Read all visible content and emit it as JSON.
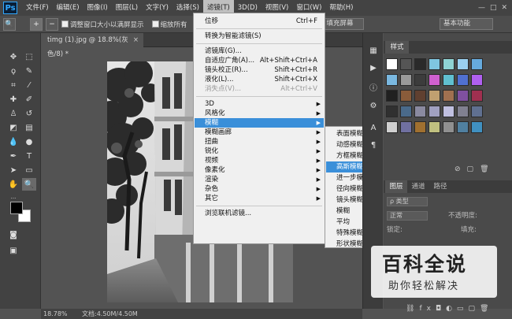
{
  "menubar": {
    "logo": "Ps",
    "items": [
      "文件(F)",
      "编辑(E)",
      "图像(I)",
      "图层(L)",
      "文字(Y)",
      "选择(S)",
      "滤镜(T)",
      "3D(D)",
      "视图(V)",
      "窗口(W)",
      "帮助(H)"
    ],
    "active_index": 6,
    "window_controls": [
      "—",
      "□",
      "✕"
    ]
  },
  "options_bar": {
    "fit_window_label": "调整窗口大小以满屏显示",
    "zoom_all_label": "缩放所有",
    "fill_screen_button": "填充屏幕",
    "workspace": "基本功能"
  },
  "document": {
    "tab_title": "timg (1).jpg @ 18.8%(灰色/8) *",
    "close": "×",
    "status_zoom": "18.78%",
    "status_doc": "文档:4.50M/4.50M"
  },
  "filter_menu": {
    "items": [
      {
        "label": "位移",
        "shortcut": "Ctrl+F"
      },
      {
        "sep": true
      },
      {
        "label": "转换为智能滤镜(S)"
      },
      {
        "sep": true
      },
      {
        "label": "滤镜库(G)..."
      },
      {
        "label": "自适应广角(A)...",
        "shortcut": "Alt+Shift+Ctrl+A"
      },
      {
        "label": "镜头校正(R)...",
        "shortcut": "Shift+Ctrl+R"
      },
      {
        "label": "液化(L)...",
        "shortcut": "Shift+Ctrl+X"
      },
      {
        "label": "消失点(V)...",
        "shortcut": "Alt+Ctrl+V",
        "disabled": true
      },
      {
        "sep": true
      },
      {
        "label": "3D",
        "submenu": true
      },
      {
        "label": "风格化",
        "submenu": true
      },
      {
        "label": "模糊",
        "submenu": true,
        "highlight": true
      },
      {
        "label": "模糊画廊",
        "submenu": true
      },
      {
        "label": "扭曲",
        "submenu": true
      },
      {
        "label": "锐化",
        "submenu": true
      },
      {
        "label": "视频",
        "submenu": true
      },
      {
        "label": "像素化",
        "submenu": true
      },
      {
        "label": "渲染",
        "submenu": true
      },
      {
        "label": "杂色",
        "submenu": true
      },
      {
        "label": "其它",
        "submenu": true
      },
      {
        "sep": true
      },
      {
        "label": "浏览联机滤镜..."
      }
    ]
  },
  "blur_submenu": {
    "items": [
      "表面模糊...",
      "动感模糊...",
      "方框模糊...",
      "高斯模糊...",
      "进一步模糊",
      "径向模糊...",
      "镜头模糊...",
      "模糊",
      "平均",
      "特殊模糊...",
      "形状模糊..."
    ],
    "highlight_index": 3
  },
  "styles_panel": {
    "tab": "样式"
  },
  "layers_panel": {
    "tabs": [
      "图层",
      "通道",
      "路径"
    ],
    "kind_label": "ρ 类型",
    "mode": "正常",
    "opacity_label": "不透明度:",
    "lock_label": "锁定:",
    "fill_label": "填充:"
  },
  "watermark": {
    "title": "百科全说",
    "subtitle": "助你轻松解决"
  }
}
